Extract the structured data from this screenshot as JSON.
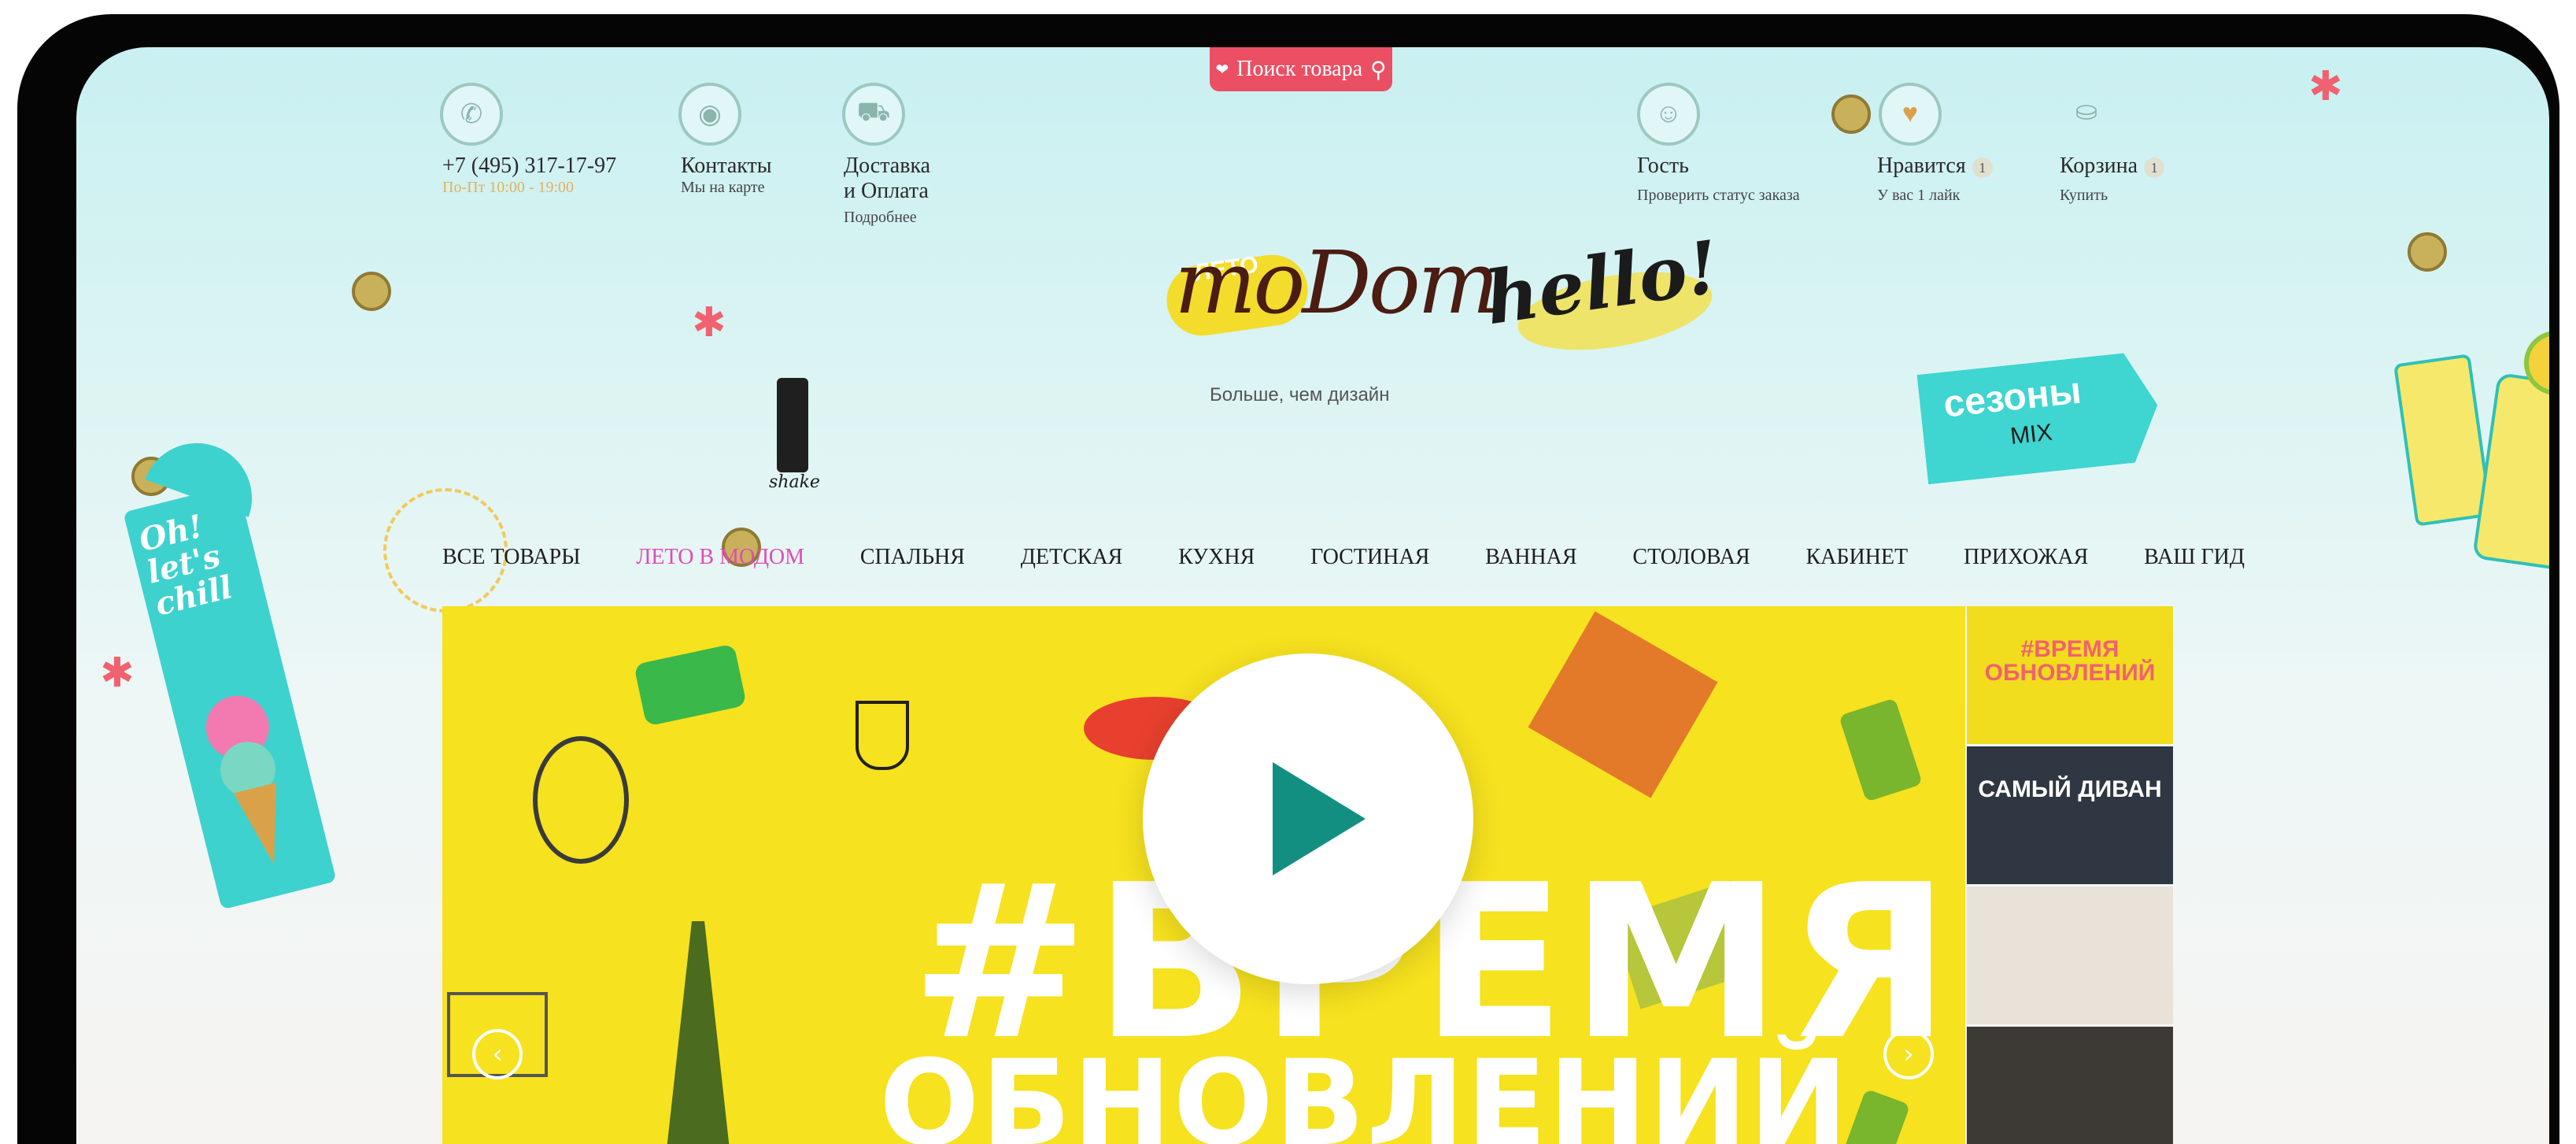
{
  "search": {
    "label": "Поиск товара"
  },
  "header": {
    "phone": {
      "number": "+7 (495) 317-17-97",
      "hours": "По-Пт 10:00 - 19:00"
    },
    "contacts": {
      "title": "Контакты",
      "sub": "Мы на карте"
    },
    "delivery": {
      "title1": "Доставка",
      "title2": "и Оплата",
      "sub": "Подробнее"
    },
    "guest": {
      "title": "Гость",
      "sub": "Проверить статус заказа"
    },
    "likes": {
      "title": "Нравится",
      "count": "1",
      "sub": "У вас 1 лайк"
    },
    "cart": {
      "title": "Корзина",
      "count": "1",
      "sub": "Купить"
    }
  },
  "logo": {
    "badge": "ЛЕТО",
    "name": "moDom",
    "tagline": "Больше, чем дизайн",
    "hello": "hello!"
  },
  "promo": {
    "seasons": "сезоны",
    "mix": "MIX"
  },
  "nav": {
    "items": [
      "ВСЕ ТОВАРЫ",
      "ЛЕТО В МОДОМ",
      "СПАЛЬНЯ",
      "ДЕТСКАЯ",
      "КУХНЯ",
      "ГОСТИНАЯ",
      "ВАННАЯ",
      "СТОЛОВАЯ",
      "КАБИНЕТ",
      "ПРИХОЖАЯ",
      "ВАШ ГИД"
    ]
  },
  "hero": {
    "line1": "#ВРЕМЯ",
    "line2": "ОБНОВЛЕНИЙ"
  },
  "thumbs": [
    {
      "caption": "#ВРЕМЯ ОБНОВЛЕНИЙ",
      "color": "#f2dc1e"
    },
    {
      "caption": "САМЫЙ ДИВАН",
      "color": "#2f3742"
    },
    {
      "caption": "",
      "color": "#e8e2d8"
    },
    {
      "caption": "",
      "color": "#3d3a36"
    }
  ],
  "decor": {
    "oh": "Oh! let's chill",
    "shake": "shake"
  },
  "colors": {
    "accent": "#ea4f63",
    "hero": "#f6e21e",
    "play": "#138f82",
    "active_nav": "#e14bb5"
  }
}
